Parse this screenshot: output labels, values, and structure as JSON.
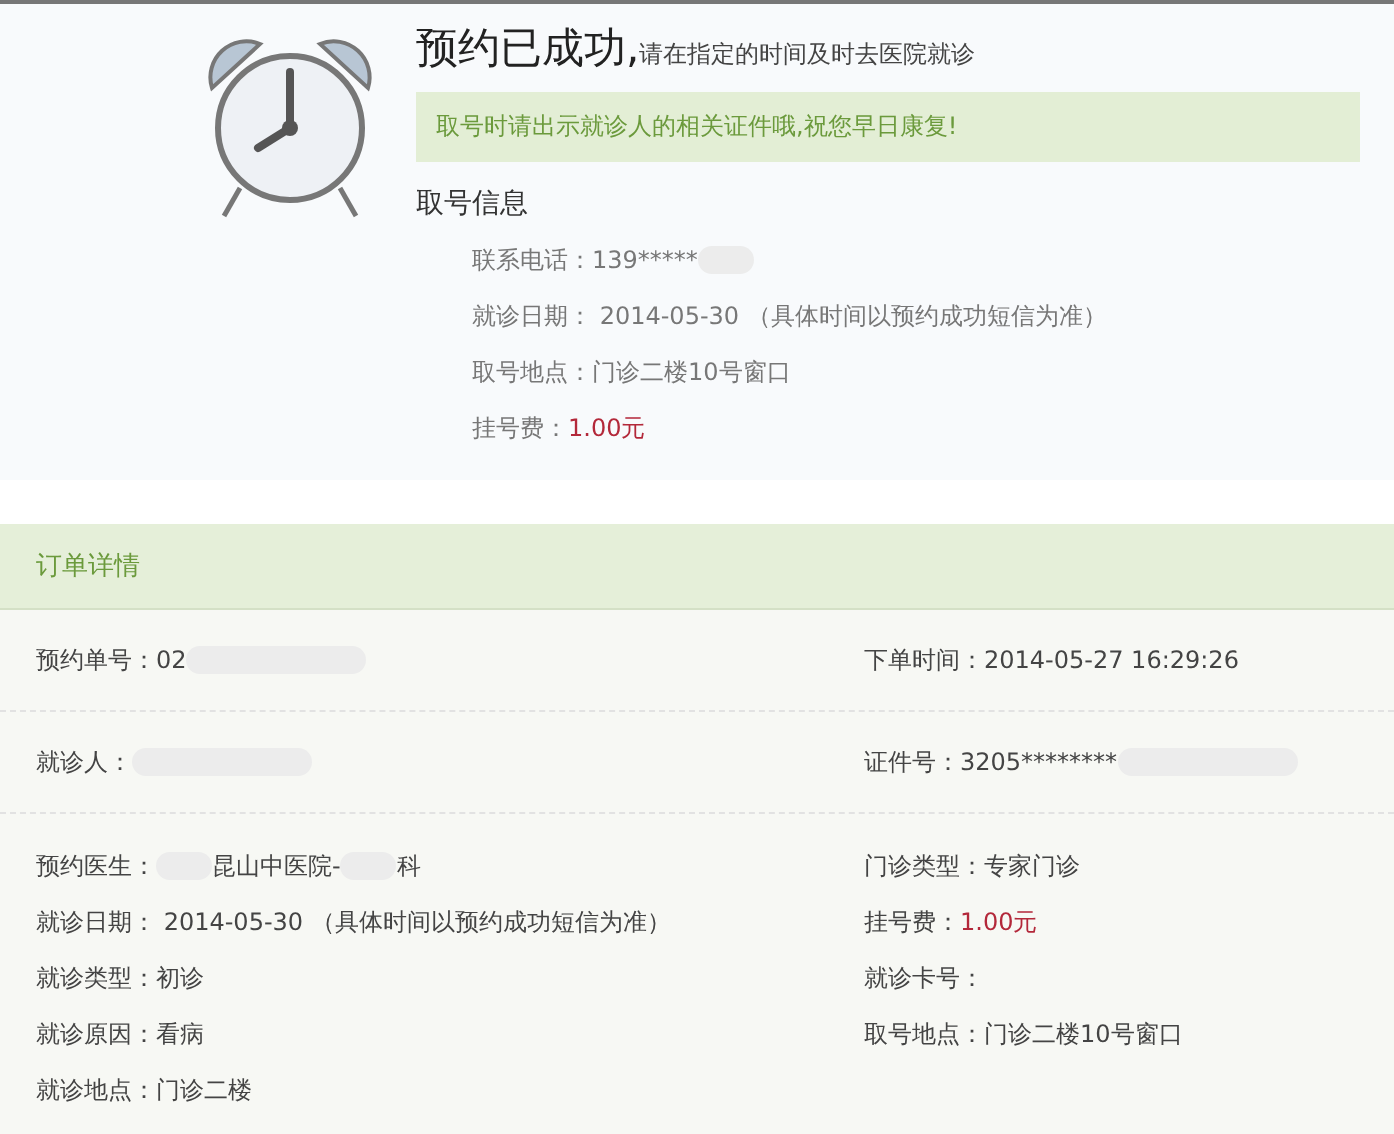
{
  "success": {
    "title": "预约已成功,",
    "subtitle": "请在指定的时间及时去医院就诊",
    "notice": "取号时请出示就诊人的相关证件哦,祝您早日康复!",
    "info_heading": "取号信息",
    "info": [
      {
        "label": "联系电话：",
        "value": "139*****",
        "kind": "text",
        "redacted": true
      },
      {
        "label": "就诊日期：",
        "value": " 2014-05-30 （具体时间以预约成功短信为准）",
        "kind": "text",
        "redacted": false
      },
      {
        "label": "取号地点：",
        "value": "门诊二楼10号窗口",
        "kind": "text",
        "redacted": false
      },
      {
        "label": "挂号费：",
        "value": "1.00元",
        "kind": "price",
        "redacted": false
      }
    ]
  },
  "order": {
    "title": "订单详情",
    "top_rows": [
      [
        {
          "label": "预约单号：",
          "segments": [
            "02"
          ],
          "redacted": true,
          "kind": "text"
        },
        {
          "label": "下单时间：",
          "segments": [
            "2014-05-27 16:29:26"
          ],
          "redacted": false,
          "kind": "text"
        }
      ],
      [
        {
          "label": "就诊人：",
          "redacted": true
        },
        {
          "label": "证件号：",
          "segments": [
            "3205********"
          ],
          "redacted": true,
          "kind": "text"
        }
      ]
    ],
    "left": [
      {
        "label": "预约医生：",
        "segments": [
          "昆山中医院-",
          "科"
        ],
        "redacted": true,
        "kind": "text"
      },
      {
        "label": "就诊日期：",
        "segments": [
          " 2014-05-30 （具体时间以预约成功短信为准）"
        ],
        "redacted": false,
        "kind": "text"
      },
      {
        "label": "就诊类型：",
        "segments": [
          "初诊"
        ],
        "redacted": false,
        "kind": "text"
      },
      {
        "label": "就诊原因：",
        "segments": [
          "看病"
        ],
        "redacted": false,
        "kind": "text"
      },
      {
        "label": "就诊地点：",
        "segments": [
          "门诊二楼"
        ],
        "redacted": false,
        "kind": "text"
      }
    ],
    "right": [
      {
        "label": "门诊类型：",
        "segments": [
          "专家门诊"
        ],
        "redacted": false,
        "kind": "text"
      },
      {
        "label": "挂号费：",
        "segments": [
          "1.00元"
        ],
        "redacted": false,
        "kind": "price"
      },
      {
        "label": "就诊卡号：",
        "redacted": false
      },
      {
        "label": "取号地点：",
        "segments": [
          "门诊二楼10号窗口"
        ],
        "redacted": false,
        "kind": "text"
      }
    ]
  }
}
